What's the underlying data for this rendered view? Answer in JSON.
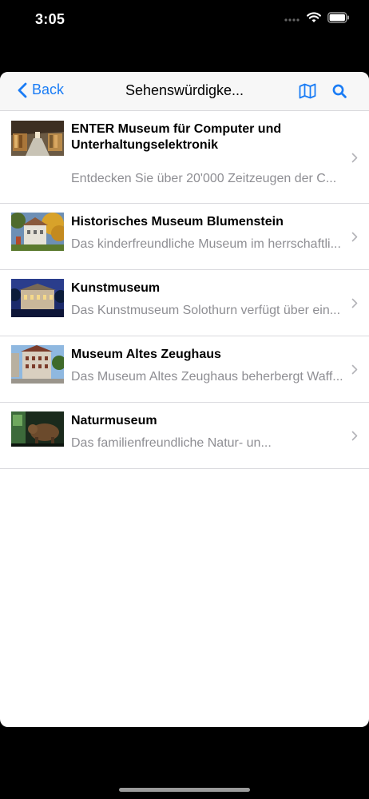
{
  "status_bar": {
    "time": "3:05"
  },
  "navbar": {
    "back_label": "Back",
    "title": "Sehenswürdigke...",
    "accent_color": "#1a7cf5"
  },
  "items": [
    {
      "title": "ENTER Museum für Computer und Unterhaltungselektronik",
      "subtitle": "Entdecken Sie über 20'000 Zeitzeugen der C..."
    },
    {
      "title": "Historisches Museum Blumenstein",
      "subtitle": "Das kinderfreundliche Museum im herrschaftli..."
    },
    {
      "title": "Kunstmuseum",
      "subtitle": "Das Kunstmuseum Solothurn verfügt über ein..."
    },
    {
      "title": "Museum Altes Zeughaus",
      "subtitle": "Das Museum Altes Zeughaus beherbergt Waff..."
    },
    {
      "title": "Naturmuseum",
      "subtitle": "Das familienfreundliche Natur- un..."
    }
  ]
}
